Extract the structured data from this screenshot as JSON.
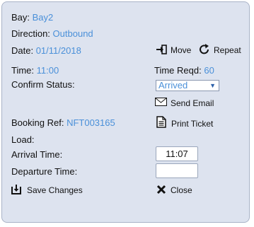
{
  "bay": {
    "label": "Bay:",
    "value": "Bay2"
  },
  "direction": {
    "label": "Direction:",
    "value": "Outbound"
  },
  "date": {
    "label": "Date:",
    "value": "01/11/2018"
  },
  "time": {
    "label": "Time:",
    "value": "11:00"
  },
  "time_reqd": {
    "label": "Time Reqd:",
    "value": "60"
  },
  "confirm_status": {
    "label": "Confirm Status:",
    "selected": "Arrived"
  },
  "booking_ref": {
    "label": "Booking Ref:",
    "value": "NFT003165"
  },
  "load": {
    "label": "Load:"
  },
  "arrival_time": {
    "label": "Arrival Time:",
    "value": "11:07"
  },
  "departure_time": {
    "label": "Departure Time:",
    "value": ""
  },
  "actions": {
    "move": "Move",
    "repeat": "Repeat",
    "send_email": "Send Email",
    "print_ticket": "Print Ticket",
    "save_changes": "Save Changes",
    "close": "Close"
  },
  "icons": {
    "move": "move-icon",
    "repeat": "repeat-icon",
    "email": "envelope-icon",
    "print": "document-icon",
    "save": "save-icon",
    "close": "close-x-icon"
  },
  "colors": {
    "accent": "#4a90d9",
    "panel": "#dde3ef"
  }
}
